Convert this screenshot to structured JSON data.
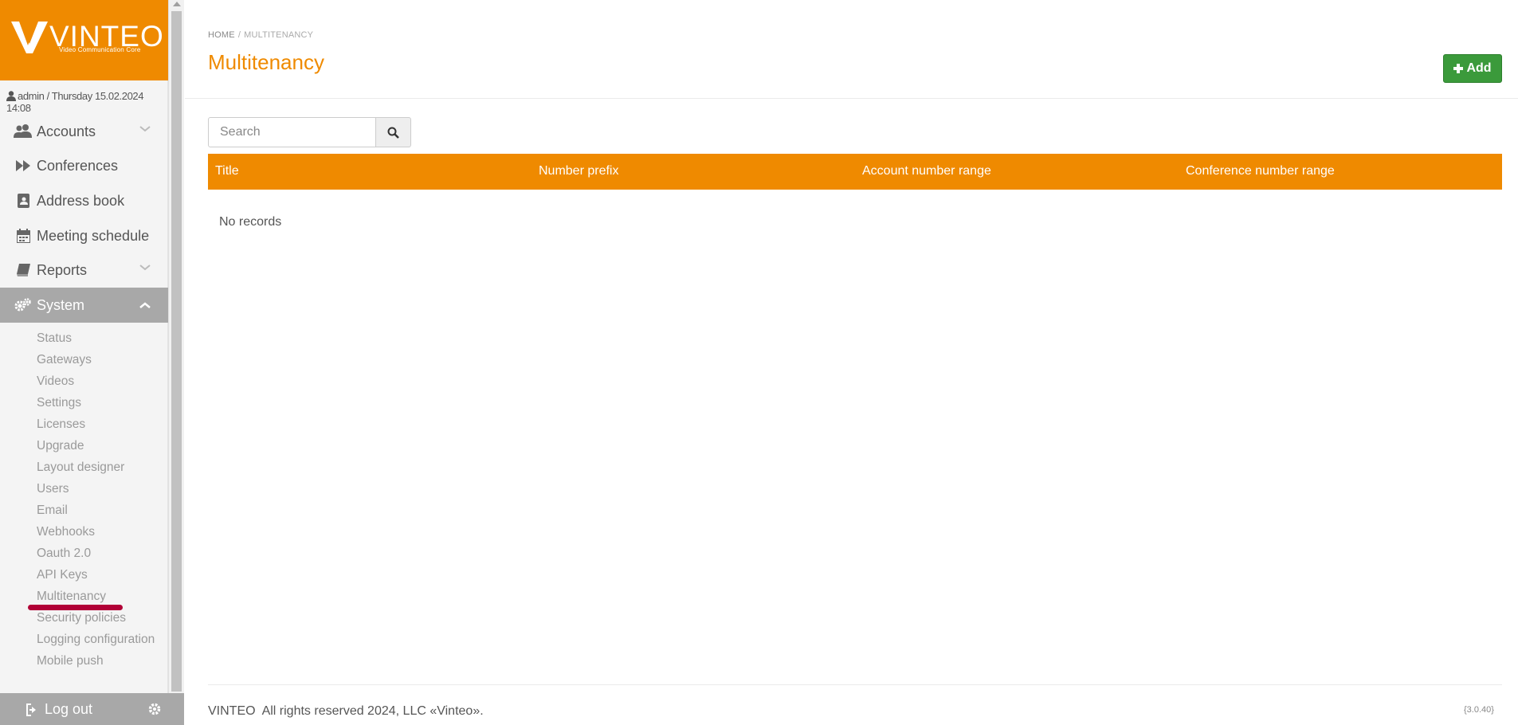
{
  "brand": {
    "name": "VINTEO",
    "tagline": "Video Communication Core",
    "color": "#ef8a00"
  },
  "user_line": "admin / Thursday 15.02.2024 14:08",
  "nav": [
    {
      "label": "Accounts",
      "icon": "users-icon",
      "expandable": true
    },
    {
      "label": "Conferences",
      "icon": "fast-forward-icon",
      "expandable": false
    },
    {
      "label": "Address book",
      "icon": "contact-book-icon",
      "expandable": false
    },
    {
      "label": "Meeting schedule",
      "icon": "calendar-icon",
      "expandable": false
    },
    {
      "label": "Reports",
      "icon": "book-icon",
      "expandable": true
    },
    {
      "label": "System",
      "icon": "cogs-icon",
      "expandable": true,
      "expanded": true
    }
  ],
  "system_submenu": [
    "Status",
    "Gateways",
    "Videos",
    "Settings",
    "Licenses",
    "Upgrade",
    "Layout designer",
    "Users",
    "Email",
    "Webhooks",
    "Oauth 2.0",
    "API Keys",
    "Multitenancy",
    "Security policies",
    "Logging configuration",
    "Mobile push"
  ],
  "sidebar_footer": {
    "logout_label": "Log out"
  },
  "breadcrumb": {
    "home": "HOME",
    "separator": "/",
    "current": "MULTITENANCY"
  },
  "page_title": "Multitenancy",
  "add_button": {
    "label": "Add",
    "color": "#3b9a3b"
  },
  "search": {
    "placeholder": "Search",
    "value": ""
  },
  "table": {
    "columns": [
      "Title",
      "Number prefix",
      "Account number range",
      "Conference number range"
    ],
    "rows": [],
    "empty_text": "No records"
  },
  "footer": {
    "brand": "VINTEO",
    "copyright": "All rights reserved 2024, LLC «Vinteo».",
    "version": "{3.0.40}"
  },
  "highlight_color": "#b10036"
}
